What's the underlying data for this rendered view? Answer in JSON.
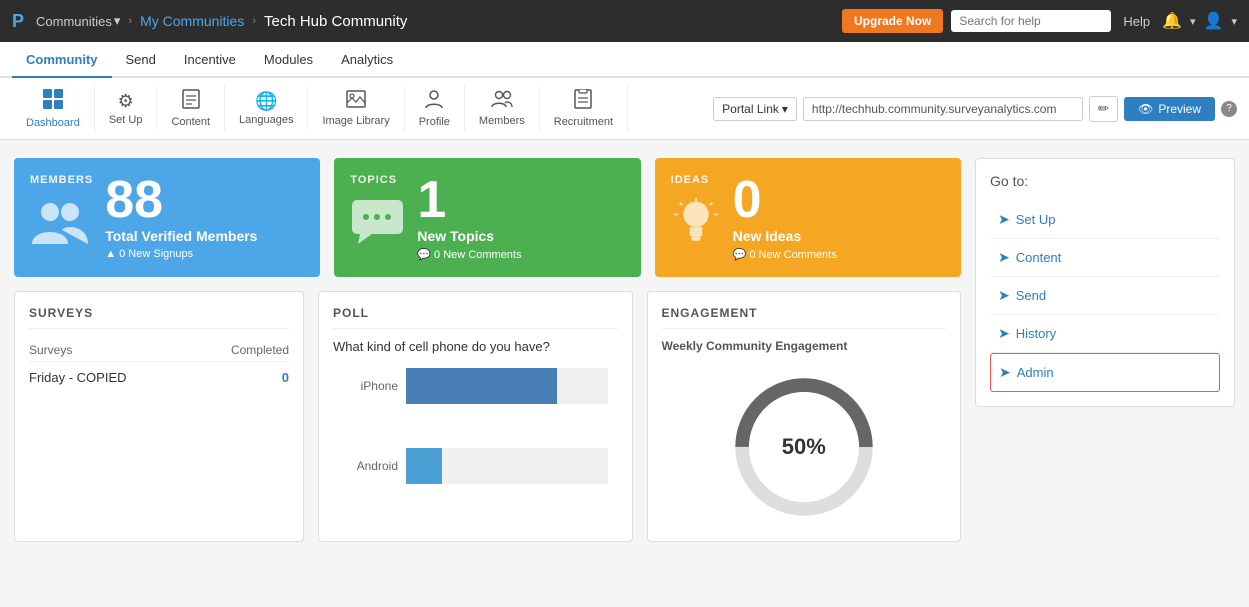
{
  "topNav": {
    "logo": "P",
    "communitiesLabel": "Communities",
    "breadcrumb1": "My Communities",
    "breadcrumb2": "Tech Hub Community",
    "upgradeBtn": "Upgrade Now",
    "searchPlaceholder": "Search for help",
    "helpLabel": "Help"
  },
  "secNav": {
    "items": [
      {
        "id": "community",
        "label": "Community",
        "active": true
      },
      {
        "id": "send",
        "label": "Send",
        "active": false
      },
      {
        "id": "incentive",
        "label": "Incentive",
        "active": false
      },
      {
        "id": "modules",
        "label": "Modules",
        "active": false
      },
      {
        "id": "analytics",
        "label": "Analytics",
        "active": false
      }
    ]
  },
  "toolbar": {
    "items": [
      {
        "id": "dashboard",
        "label": "Dashboard",
        "icon": "⊞",
        "active": true
      },
      {
        "id": "setup",
        "label": "Set Up",
        "icon": "⚙",
        "active": false
      },
      {
        "id": "content",
        "label": "Content",
        "icon": "📄",
        "active": false
      },
      {
        "id": "languages",
        "label": "Languages",
        "icon": "🌐",
        "active": false
      },
      {
        "id": "imageLibrary",
        "label": "Image Library",
        "icon": "🖼",
        "active": false
      },
      {
        "id": "profile",
        "label": "Profile",
        "icon": "👤",
        "active": false
      },
      {
        "id": "members",
        "label": "Members",
        "icon": "👥",
        "active": false
      },
      {
        "id": "recruitment",
        "label": "Recruitment",
        "icon": "📋",
        "active": false
      }
    ],
    "portalLinkLabel": "Portal Link",
    "portalUrl": "http://techhub.community.surveyanalytics.com",
    "previewLabel": "Preview"
  },
  "stats": {
    "members": {
      "label": "MEMBERS",
      "count": "88",
      "description": "Total Verified Members",
      "sub": "0 New Signups"
    },
    "topics": {
      "label": "TOPICS",
      "count": "1",
      "description": "New Topics",
      "sub": "0 New Comments"
    },
    "ideas": {
      "label": "IDEAS",
      "count": "0",
      "description": "New Ideas",
      "sub": "0 New Comments"
    }
  },
  "surveys": {
    "title": "SURVEYS",
    "col1": "Surveys",
    "col2": "Completed",
    "rows": [
      {
        "name": "Friday - COPIED",
        "completed": "0"
      }
    ]
  },
  "poll": {
    "title": "POLL",
    "question": "What kind of cell phone do you have?",
    "bars": [
      {
        "label": "iPhone",
        "value": 75,
        "colorClass": ""
      },
      {
        "label": "Android",
        "value": 18,
        "colorClass": "small"
      }
    ]
  },
  "engagement": {
    "title": "ENGAGEMENT",
    "subtitle": "Weekly Community Engagement",
    "percentage": "50%",
    "donut": {
      "filled": 50,
      "total": 100,
      "filledColor": "#666",
      "emptyColor": "#ddd"
    }
  },
  "sidebar": {
    "title": "Go to:",
    "items": [
      {
        "id": "setup",
        "label": "Set Up",
        "isAdmin": false
      },
      {
        "id": "content",
        "label": "Content",
        "isAdmin": false
      },
      {
        "id": "send",
        "label": "Send",
        "isAdmin": false
      },
      {
        "id": "history",
        "label": "History",
        "isAdmin": false
      },
      {
        "id": "admin",
        "label": "Admin",
        "isAdmin": true
      }
    ]
  }
}
